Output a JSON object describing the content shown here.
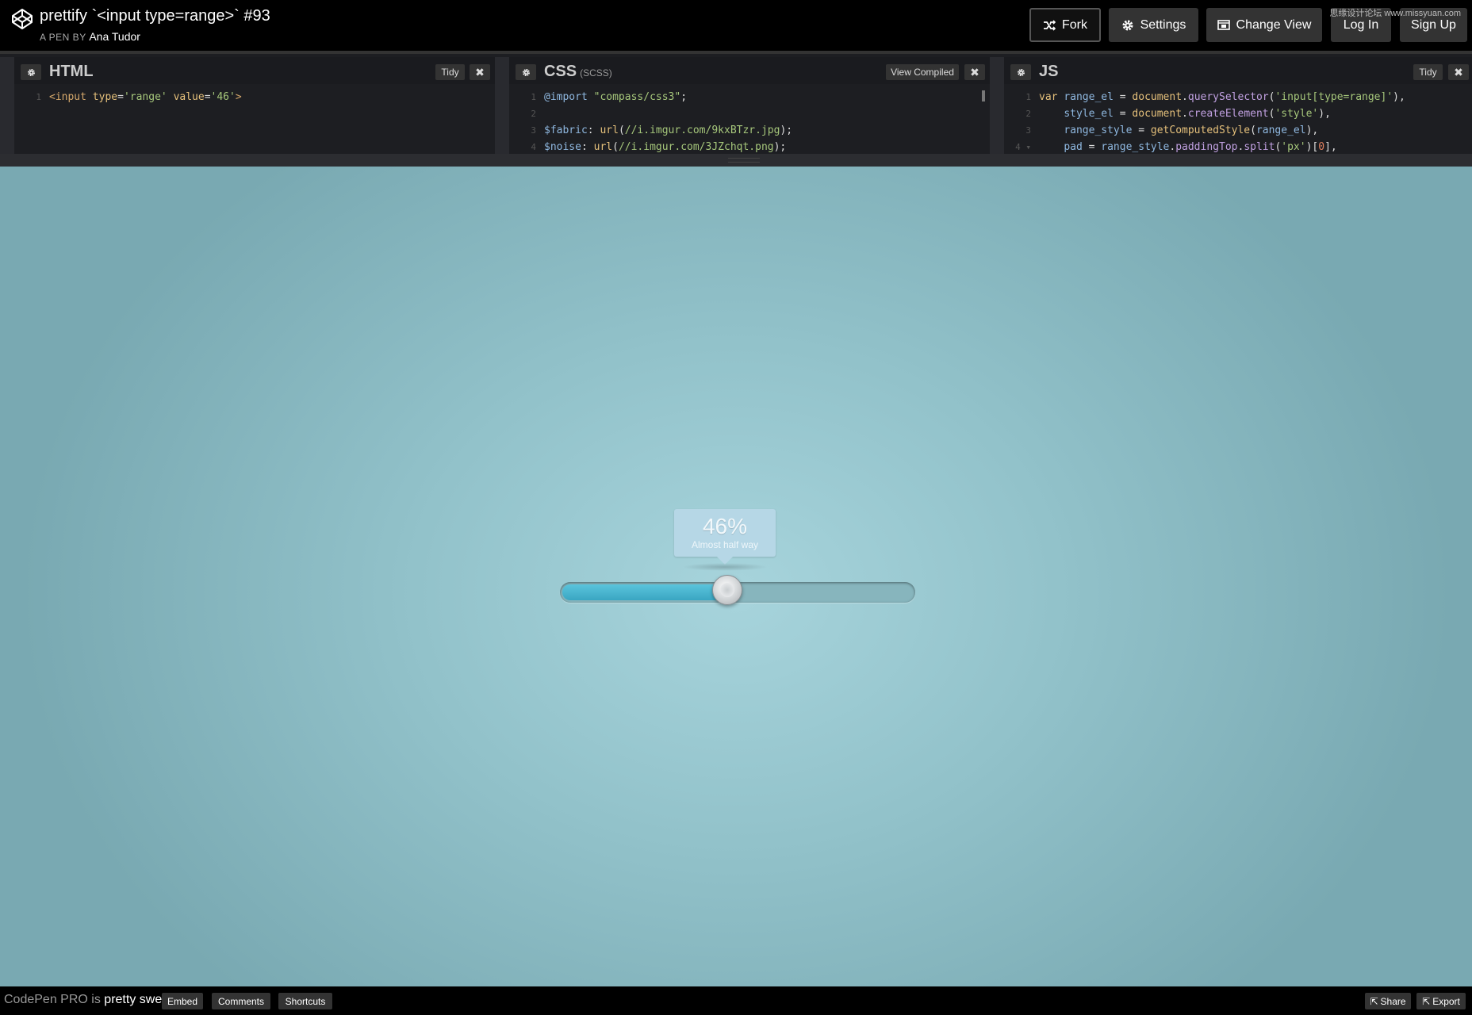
{
  "header": {
    "title": "prettify `<input type=range>` #93",
    "pen_by_prefix": "A PEN BY",
    "author": "Ana Tudor",
    "buttons": {
      "fork": "Fork",
      "settings": "Settings",
      "change_view": "Change View",
      "login": "Log In",
      "signup": "Sign Up"
    },
    "watermark": "思缘设计论坛 www.missyuan.com"
  },
  "editors": {
    "html": {
      "title": "HTML",
      "tidy": "Tidy",
      "lines": [
        {
          "n": "1",
          "parts": [
            [
              "tk-tag",
              "<input "
            ],
            [
              "tk-attr",
              "type"
            ],
            [
              "tk-plain",
              "="
            ],
            [
              "tk-str",
              "'range'"
            ],
            [
              "tk-plain",
              " "
            ],
            [
              "tk-attr",
              "value"
            ],
            [
              "tk-plain",
              "="
            ],
            [
              "tk-str",
              "'46'"
            ],
            [
              "tk-tag",
              ">"
            ]
          ]
        }
      ]
    },
    "css": {
      "title": "CSS",
      "subtitle": "(SCSS)",
      "view_compiled": "View Compiled",
      "lines": [
        {
          "n": "1",
          "parts": [
            [
              "tk-var",
              "@import"
            ],
            [
              "tk-plain",
              " "
            ],
            [
              "tk-str",
              "\"compass/css3\""
            ],
            [
              "tk-plain",
              ";"
            ]
          ]
        },
        {
          "n": "2",
          "parts": []
        },
        {
          "n": "3",
          "parts": [
            [
              "tk-var",
              "$fabric"
            ],
            [
              "tk-plain",
              ": "
            ],
            [
              "tk-fn",
              "url"
            ],
            [
              "tk-plain",
              "("
            ],
            [
              "tk-str",
              "//i.imgur.com/9kxBTzr.jpg"
            ],
            [
              "tk-plain",
              ");"
            ]
          ]
        },
        {
          "n": "4",
          "parts": [
            [
              "tk-var",
              "$noise"
            ],
            [
              "tk-plain",
              ": "
            ],
            [
              "tk-fn",
              "url"
            ],
            [
              "tk-plain",
              "("
            ],
            [
              "tk-str",
              "//i.imgur.com/3JZchqt.png"
            ],
            [
              "tk-plain",
              ");"
            ]
          ]
        }
      ]
    },
    "js": {
      "title": "JS",
      "tidy": "Tidy",
      "lines": [
        {
          "n": "1",
          "parts": [
            [
              "tk-kw",
              "var"
            ],
            [
              "tk-plain",
              " "
            ],
            [
              "tk-var",
              "range_el"
            ],
            [
              "tk-plain",
              " = "
            ],
            [
              "tk-fn",
              "document"
            ],
            [
              "tk-plain",
              "."
            ],
            [
              "tk-prop",
              "querySelector"
            ],
            [
              "tk-plain",
              "("
            ],
            [
              "tk-str",
              "'input[type=range]'"
            ],
            [
              "tk-plain",
              "),"
            ]
          ]
        },
        {
          "n": "2",
          "parts": [
            [
              "tk-plain",
              "    "
            ],
            [
              "tk-var",
              "style_el"
            ],
            [
              "tk-plain",
              " = "
            ],
            [
              "tk-fn",
              "document"
            ],
            [
              "tk-plain",
              "."
            ],
            [
              "tk-prop",
              "createElement"
            ],
            [
              "tk-plain",
              "("
            ],
            [
              "tk-str",
              "'style'"
            ],
            [
              "tk-plain",
              "),"
            ]
          ]
        },
        {
          "n": "3",
          "parts": [
            [
              "tk-plain",
              "    "
            ],
            [
              "tk-var",
              "range_style"
            ],
            [
              "tk-plain",
              " = "
            ],
            [
              "tk-fn",
              "getComputedStyle"
            ],
            [
              "tk-plain",
              "("
            ],
            [
              "tk-var",
              "range_el"
            ],
            [
              "tk-plain",
              "),"
            ]
          ]
        },
        {
          "n": "4 ▾",
          "parts": [
            [
              "tk-plain",
              "    "
            ],
            [
              "tk-var",
              "pad"
            ],
            [
              "tk-plain",
              " = "
            ],
            [
              "tk-var",
              "range_style"
            ],
            [
              "tk-plain",
              "."
            ],
            [
              "tk-prop",
              "paddingTop"
            ],
            [
              "tk-plain",
              "."
            ],
            [
              "tk-prop",
              "split"
            ],
            [
              "tk-plain",
              "("
            ],
            [
              "tk-str",
              "'px'"
            ],
            [
              "tk-plain",
              ")["
            ],
            [
              "tk-num",
              "0"
            ],
            [
              "tk-plain",
              "],"
            ]
          ]
        }
      ]
    }
  },
  "preview": {
    "slider": {
      "value": 46,
      "min": 0,
      "max": 100,
      "tooltip_value": "46%",
      "tooltip_label": "Almost half way"
    }
  },
  "footer": {
    "promo_prefix": "CodePen PRO is",
    "promo_highlight": "pretty sweet.",
    "embed": "Embed",
    "comments": "Comments",
    "shortcuts": "Shortcuts",
    "share": "Share",
    "export": "Export"
  }
}
